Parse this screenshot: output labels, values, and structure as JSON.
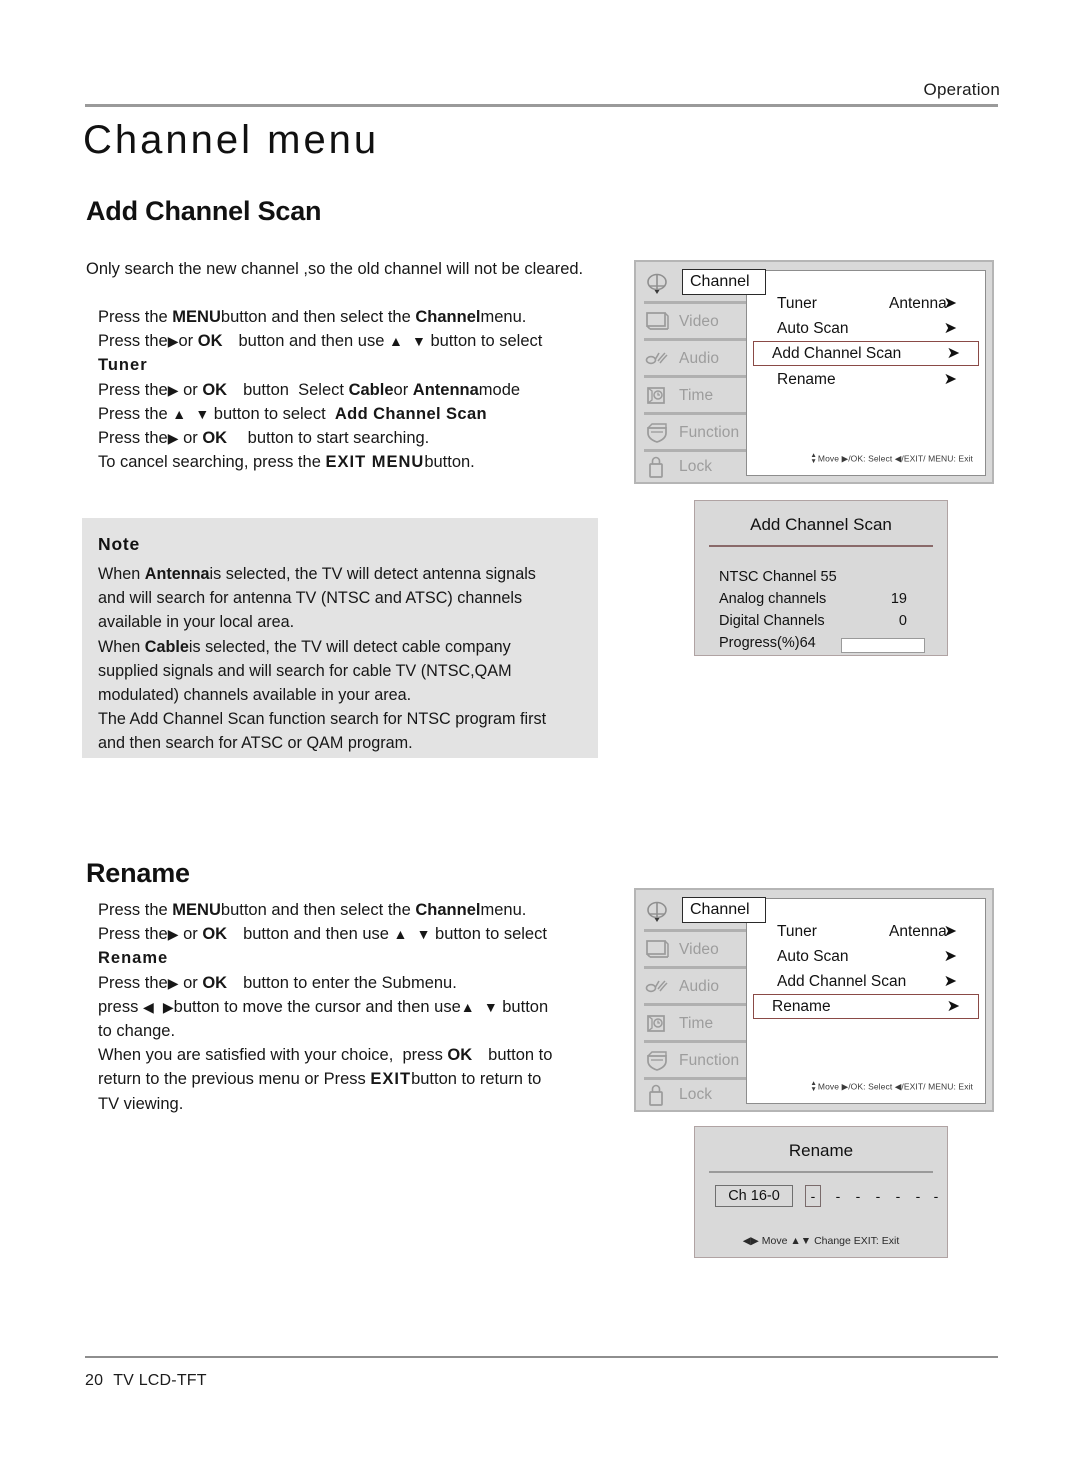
{
  "header": {
    "section_label": "Operation"
  },
  "page_title": "Channel  menu",
  "sections": {
    "add_scan": {
      "title": "Add Channel Scan",
      "lead": "Only search the new channel ,so the old channel will not be cleared.",
      "steps": [
        {
          "parts": [
            "Press the ",
            "MENU",
            " button and then select the ",
            "Channel",
            " menu."
          ]
        },
        {
          "parts": [
            "Press the ▶or ",
            "OK",
            "   button and then use ▲  ▼ button to select"
          ]
        },
        {
          "bold_line": "Tuner"
        },
        {
          "parts": [
            "Press the ▶ or ",
            "OK",
            "   button  Select ",
            "Cable",
            " or ",
            "Antenna",
            " mode"
          ]
        },
        {
          "parts": [
            "Press the  ▲  ▼ button to select  ",
            "Add Channel Scan"
          ]
        },
        {
          "parts": [
            "Press the ▶ or ",
            "OK",
            "    button to start searching."
          ]
        },
        {
          "parts": [
            "To cancel searching, press the ",
            "EXIT MENU",
            " button."
          ]
        }
      ]
    },
    "rename": {
      "title": "Rename",
      "steps": [
        {
          "parts": [
            "Press the ",
            "MENU",
            " button and then select the ",
            "Channel",
            " menu."
          ]
        },
        {
          "parts": [
            "Press the ▶ or ",
            "OK",
            "   button and then use ▲  ▼ button to select"
          ]
        },
        {
          "bold_line": "Rename"
        },
        {
          "parts": [
            "Press the ▶ or ",
            "OK",
            "   button to enter the Submenu."
          ]
        },
        {
          "parts": [
            "press ◀  ▶ button to move the cursor and then use ▲  ▼ button"
          ]
        },
        {
          "parts": [
            "to change."
          ]
        },
        {
          "parts": [
            "When you are satisfied with your choice,  press ",
            "OK",
            "   button to"
          ]
        },
        {
          "parts": [
            "return to the previous menu or Press ",
            "EXIT",
            " button to return to"
          ]
        },
        {
          "parts": [
            "TV viewing."
          ]
        }
      ]
    }
  },
  "note": {
    "heading": "Note",
    "lines": [
      {
        "parts": [
          "When ",
          "Antenna",
          " is selected, the TV will detect antenna signals"
        ]
      },
      {
        "parts": [
          "and will search for antenna TV (NTSC and ATSC) channels"
        ]
      },
      {
        "parts": [
          "available in your local area."
        ]
      },
      {
        "parts": [
          "When ",
          "Cable",
          " is selected, the TV will detect cable company"
        ]
      },
      {
        "parts": [
          "supplied signals and will search for cable TV (NTSC,QAM"
        ]
      },
      {
        "parts": [
          "modulated) channels available in your area."
        ]
      },
      {
        "parts": [
          "The Add Channel Scan function search for NTSC program first"
        ]
      },
      {
        "parts": [
          "and then search for ATSC or QAM program."
        ]
      }
    ]
  },
  "osd": {
    "sidebar": [
      {
        "label": "Channel",
        "icon": "satellite-dish-icon",
        "active": true
      },
      {
        "label": "Video",
        "icon": "monitor-icon",
        "active": false
      },
      {
        "label": "Audio",
        "icon": "music-note-icon",
        "active": false
      },
      {
        "label": "Time",
        "icon": "clock-icon",
        "active": false
      },
      {
        "label": "Function",
        "icon": "function-box-icon",
        "active": false
      },
      {
        "label": "Lock",
        "icon": "padlock-icon",
        "active": false
      }
    ],
    "items": [
      {
        "name": "Tuner",
        "value": "Antenna",
        "arrow": "➤"
      },
      {
        "name": "Auto Scan",
        "value": "",
        "arrow": "➤"
      },
      {
        "name": "Add Channel Scan",
        "value": "",
        "arrow": "➤"
      },
      {
        "name": "Rename",
        "value": "",
        "arrow": "➤"
      }
    ],
    "selected_first": "Add Channel Scan",
    "selected_second": "Rename",
    "hint": "Move  ▶/OK: Select  ◀/EXIT/ MENU: Exit",
    "hint_move_label": "Move",
    "highlight_color": "#8a4a46"
  },
  "scan_dialog": {
    "title": "Add Channel Scan",
    "rows": [
      {
        "key": "NTSC Channel 55",
        "value": ""
      },
      {
        "key": "Analog channels",
        "value": "19"
      },
      {
        "key": "Digital Channels",
        "value": "0"
      }
    ],
    "progress_label": "Progress(%)64",
    "progress_percent": 64,
    "bar_fill_color": "#6b6b6b"
  },
  "rename_dialog": {
    "title": "Rename",
    "channel_value": "Ch 16-0",
    "cursor_char": "-",
    "placeholders": [
      "-",
      "-",
      "-",
      "-",
      "-",
      "-"
    ],
    "hint": "◀▶ Move  ▲▼ Change   EXIT: Exit",
    "hint_move": "Move",
    "hint_change": "Change",
    "hint_exit": "EXIT: Exit"
  },
  "footer": {
    "page_number": "20",
    "model": "TV LCD-TFT"
  }
}
